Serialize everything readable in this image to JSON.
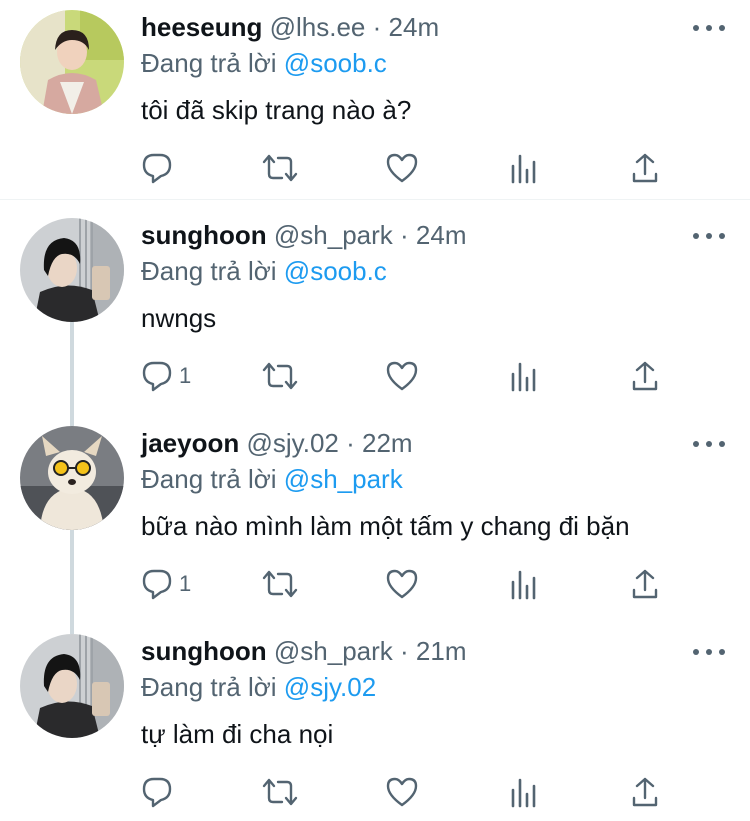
{
  "reply_prefix": "Đang trả lời",
  "tweets": [
    {
      "name": "heeseung",
      "handle": "@lhs.ee",
      "separator": "·",
      "time": "24m",
      "replying_to": "@soob.c",
      "text": "tôi đã skip trang nào à?",
      "reply_count": ""
    },
    {
      "name": "sunghoon",
      "handle": "@sh_park",
      "separator": "·",
      "time": "24m",
      "replying_to": "@soob.c",
      "text": "nwngs",
      "reply_count": "1"
    },
    {
      "name": "jaeyoon",
      "handle": "@sjy.02",
      "separator": "·",
      "time": "22m",
      "replying_to": "@sh_park",
      "text": "bữa nào mình làm một tấm y chang đi bặn",
      "reply_count": "1"
    },
    {
      "name": "sunghoon",
      "handle": "@sh_park",
      "separator": "·",
      "time": "21m",
      "replying_to": "@sjy.02",
      "text": "tự làm đi cha nọi",
      "reply_count": ""
    }
  ],
  "icons": {
    "reply": "reply-icon",
    "retweet": "retweet-icon",
    "like": "heart-icon",
    "analytics": "analytics-icon",
    "share": "share-icon",
    "more": "more-icon"
  },
  "colors": {
    "text": "#0f1419",
    "secondary": "#536471",
    "link": "#1d9bf0",
    "thread_line": "#cfd9de",
    "divider": "#eff3f4"
  }
}
